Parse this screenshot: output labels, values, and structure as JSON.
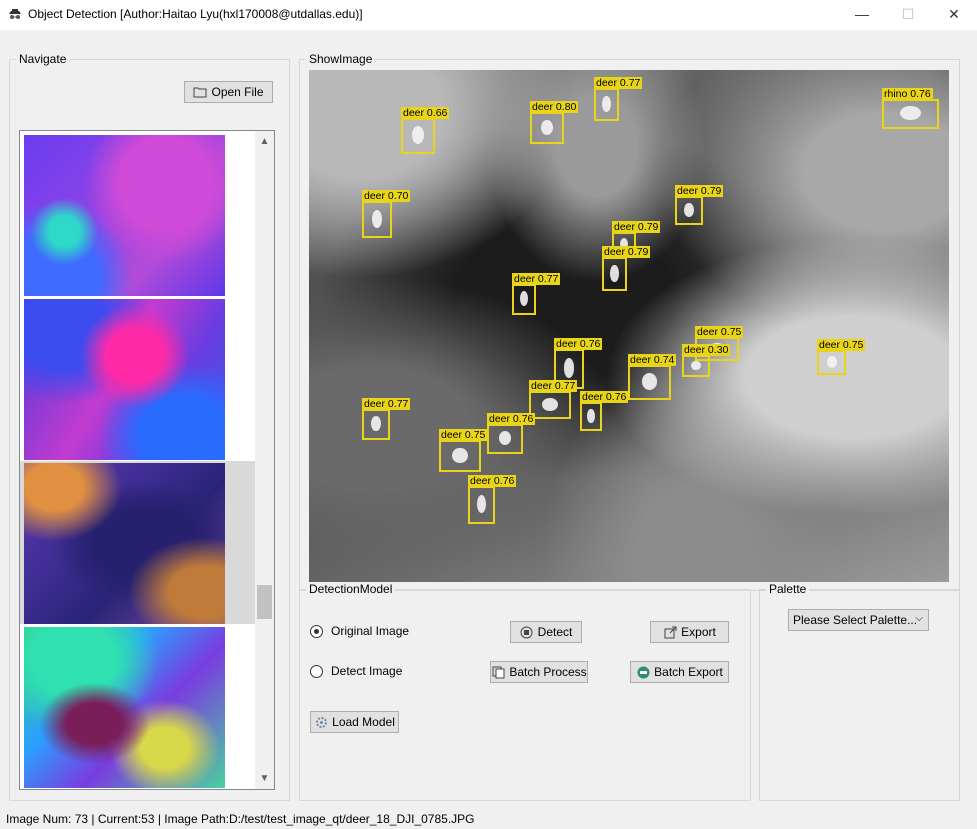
{
  "window": {
    "title": "Object Detection [Author:Haitao Lyu(hxl170008@utdallas.edu)]",
    "min": "—",
    "max": "☐",
    "close": "✕"
  },
  "navigate": {
    "group_title": "Navigate",
    "open_file": "Open File",
    "thumbnails": [
      {
        "palette": "purple-blue-cyan"
      },
      {
        "palette": "magenta-blue"
      },
      {
        "palette": "dark-purple-orange",
        "selected": true
      },
      {
        "palette": "green-blue-magenta"
      }
    ]
  },
  "show_image": {
    "group_title": "ShowImage",
    "detections": [
      {
        "label": "deer 0.66"
      },
      {
        "label": "deer 0.80"
      },
      {
        "label": "deer 0.77"
      },
      {
        "label": "rhino 0.76"
      },
      {
        "label": "deer 0.70"
      },
      {
        "label": "deer 0.79"
      },
      {
        "label": "deer 0.79"
      },
      {
        "label": "deer 0.79"
      },
      {
        "label": "deer 0.77"
      },
      {
        "label": "deer 0.76"
      },
      {
        "label": "deer 0.74"
      },
      {
        "label": "deer 0.75"
      },
      {
        "label": "deer 0.30"
      },
      {
        "label": "deer 0.75"
      },
      {
        "label": "deer 0.77"
      },
      {
        "label": "deer 0.76"
      },
      {
        "label": "deer 0.77"
      },
      {
        "label": "deer 0.76"
      },
      {
        "label": "deer 0.75"
      },
      {
        "label": "deer 0.76"
      }
    ]
  },
  "detection_model": {
    "group_title": "DetectionModel",
    "radio_original": "Original Image",
    "radio_detect": "Detect Image",
    "detect": "Detect",
    "export": "Export",
    "batch_process": "Batch Process",
    "batch_export": "Batch Export",
    "load_model": "Load Model"
  },
  "palette": {
    "group_title": "Palette",
    "select_value": "Please Select Palette..."
  },
  "status": "Image Num: 73 | Current:53 | Image Path:D:/test/test_image_qt/deer_18_DJI_0785.JPG",
  "colors": {
    "box": "#e8d51a"
  }
}
